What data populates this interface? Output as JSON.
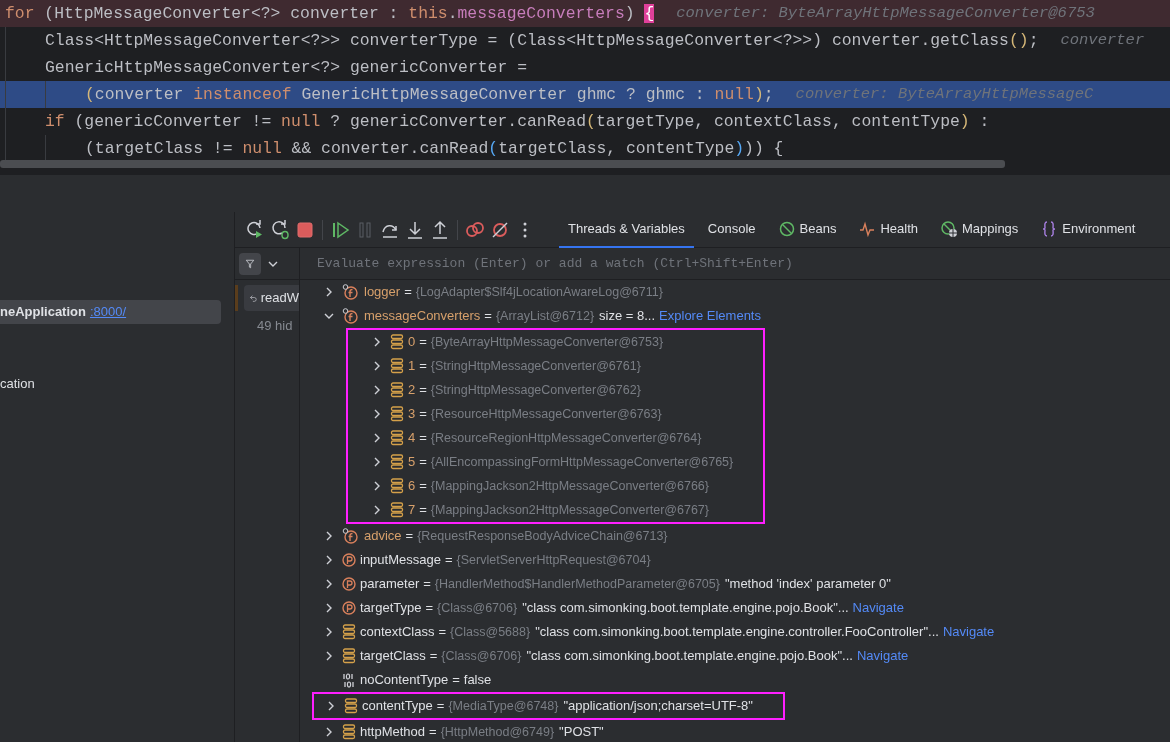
{
  "editor": {
    "lines": [
      {
        "kind": "outer",
        "breakpoint": true,
        "highlighted": false,
        "tokens": [
          {
            "t": "for",
            "kind": "keyword"
          },
          {
            "t": " (HttpMessageConverter<?> converter : ",
            "kind": "plain"
          },
          {
            "t": "this",
            "kind": "keyword"
          },
          {
            "t": ".",
            "kind": "plain"
          },
          {
            "t": "messageConverters",
            "kind": "field"
          },
          {
            "t": ") ",
            "kind": "plain"
          },
          {
            "t": "{",
            "kind": "match"
          }
        ],
        "hint": "converter: ByteArrayHttpMessageConverter@6753"
      },
      {
        "kind": "body",
        "breakpoint": false,
        "highlighted": false,
        "tokens": [
          {
            "t": "Class<HttpMessageConverter<?>> converterType = (Class<HttpMessageConverter<?>>) converter.getClass",
            "kind": "plain"
          },
          {
            "t": "()",
            "kind": "paren"
          },
          {
            "t": ";",
            "kind": "plain"
          }
        ],
        "hint": "converter"
      },
      {
        "kind": "body",
        "breakpoint": false,
        "highlighted": false,
        "tokens": [
          {
            "t": "GenericHttpMessageConverter<?> genericConverter =",
            "kind": "plain"
          }
        ]
      },
      {
        "kind": "wrapped",
        "breakpoint": false,
        "highlighted": true,
        "tokens": [
          {
            "t": "(",
            "kind": "paren"
          },
          {
            "t": "converter ",
            "kind": "plain"
          },
          {
            "t": "instanceof",
            "kind": "keyword"
          },
          {
            "t": " GenericHttpMessageConverter ghmc ? ghmc : ",
            "kind": "plain"
          },
          {
            "t": "null",
            "kind": "keyword"
          },
          {
            "t": ")",
            "kind": "paren"
          },
          {
            "t": ";",
            "kind": "plain"
          }
        ],
        "hint": "converter: ByteArrayHttpMessageC"
      },
      {
        "kind": "body",
        "breakpoint": false,
        "highlighted": false,
        "tokens": [
          {
            "t": "if",
            "kind": "keyword"
          },
          {
            "t": " (genericConverter != ",
            "kind": "plain"
          },
          {
            "t": "null",
            "kind": "keyword"
          },
          {
            "t": " ? genericConverter.canRead",
            "kind": "plain"
          },
          {
            "t": "(",
            "kind": "paren"
          },
          {
            "t": "targetType, contextClass, contentType",
            "kind": "plain"
          },
          {
            "t": ")",
            "kind": "paren"
          },
          {
            "t": " :",
            "kind": "plain"
          }
        ]
      },
      {
        "kind": "wrapped",
        "breakpoint": false,
        "highlighted": false,
        "tokens": [
          {
            "t": "(targetClass != ",
            "kind": "plain"
          },
          {
            "t": "null",
            "kind": "keyword"
          },
          {
            "t": " && converter.canRead",
            "kind": "plain"
          },
          {
            "t": "(",
            "kind": "call"
          },
          {
            "t": "targetClass, contentType",
            "kind": "plain"
          },
          {
            "t": ")",
            "kind": "call"
          },
          {
            "t": ")) {",
            "kind": "plain"
          }
        ]
      }
    ]
  },
  "services": {
    "items": [
      {
        "name": "neApplication",
        "link": ":8000/",
        "selected": true
      },
      {
        "name": "cation",
        "selected": false
      }
    ]
  },
  "toolbar": {
    "buttons": [
      {
        "kind": "rerun"
      },
      {
        "kind": "rerun-debug"
      },
      {
        "kind": "stop"
      },
      {
        "kind": "sep"
      },
      {
        "kind": "resume"
      },
      {
        "kind": "pause",
        "disabled": true
      },
      {
        "kind": "step-over"
      },
      {
        "kind": "step-into"
      },
      {
        "kind": "step-out"
      },
      {
        "kind": "sep"
      },
      {
        "kind": "breakpoints"
      },
      {
        "kind": "mute"
      },
      {
        "kind": "more"
      }
    ]
  },
  "tabs": [
    {
      "label": "Threads & Variables",
      "selected": true
    },
    {
      "label": "Console",
      "selected": false
    },
    {
      "label": "Beans",
      "selected": false
    },
    {
      "label": "Health",
      "selected": false
    },
    {
      "label": "Mappings",
      "selected": false
    },
    {
      "label": "Environment",
      "selected": false
    }
  ],
  "evaluate": {
    "placeholder": "Evaluate expression (Enter) or add a watch (Ctrl+Shift+Enter)"
  },
  "frames": {
    "current": "readW",
    "hidden": "49 hid"
  },
  "variables": [
    {
      "kind": "field",
      "name": "logger",
      "sep": "=",
      "value": "{LogAdapter$Slf4jLocationAwareLog@6711}",
      "expandable": true,
      "expanded": false
    },
    {
      "kind": "field",
      "name": "messageConverters",
      "sep": "=",
      "value": "{ArrayList@6712}",
      "extra": "size = 8...",
      "link": "Explore Elements",
      "expandable": true,
      "expanded": true,
      "children_boxed": true,
      "children": [
        {
          "kind": "element",
          "name": "0",
          "sep": "=",
          "value": "{ByteArrayHttpMessageConverter@6753}",
          "expandable": true,
          "expanded": false
        },
        {
          "kind": "element",
          "name": "1",
          "sep": "=",
          "value": "{StringHttpMessageConverter@6761}",
          "expandable": true,
          "expanded": false
        },
        {
          "kind": "element",
          "name": "2",
          "sep": "=",
          "value": "{StringHttpMessageConverter@6762}",
          "expandable": true,
          "expanded": false
        },
        {
          "kind": "element",
          "name": "3",
          "sep": "=",
          "value": "{ResourceHttpMessageConverter@6763}",
          "expandable": true,
          "expanded": false
        },
        {
          "kind": "element",
          "name": "4",
          "sep": "=",
          "value": "{ResourceRegionHttpMessageConverter@6764}",
          "expandable": true,
          "expanded": false
        },
        {
          "kind": "element",
          "name": "5",
          "sep": "=",
          "value": "{AllEncompassingFormHttpMessageConverter@6765}",
          "expandable": true,
          "expanded": false
        },
        {
          "kind": "element",
          "name": "6",
          "sep": "=",
          "value": "{MappingJackson2HttpMessageConverter@6766}",
          "expandable": true,
          "expanded": false
        },
        {
          "kind": "element",
          "name": "7",
          "sep": "=",
          "value": "{MappingJackson2HttpMessageConverter@6767}",
          "expandable": true,
          "expanded": false
        }
      ]
    },
    {
      "kind": "field",
      "name": "advice",
      "sep": "=",
      "value": "{RequestResponseBodyAdviceChain@6713}",
      "expandable": true,
      "expanded": false
    },
    {
      "kind": "param",
      "name": "inputMessage",
      "sep": "=",
      "value": "{ServletServerHttpRequest@6704}",
      "expandable": true,
      "expanded": false
    },
    {
      "kind": "param",
      "name": "parameter",
      "sep": "=",
      "value": "{HandlerMethod$HandlerMethodParameter@6705}",
      "extra": "\"method 'index' parameter 0\"",
      "expandable": true,
      "expanded": false
    },
    {
      "kind": "param",
      "name": "targetType",
      "sep": "=",
      "value": "{Class@6706}",
      "extra": "\"class com.simonking.boot.template.engine.pojo.Book\"...",
      "link": "Navigate",
      "expandable": true,
      "expanded": false
    },
    {
      "kind": "object",
      "name": "contextClass",
      "sep": "=",
      "value": "{Class@5688}",
      "extra": "\"class com.simonking.boot.template.engine.controller.FooController\"...",
      "link": "Navigate",
      "expandable": true,
      "expanded": false
    },
    {
      "kind": "object",
      "name": "targetClass",
      "sep": "=",
      "value": "{Class@6706}",
      "extra": "\"class com.simonking.boot.template.engine.pojo.Book\"...",
      "link": "Navigate",
      "expandable": true,
      "expanded": false
    },
    {
      "kind": "primitive",
      "name": "noContentType",
      "sep": "=",
      "value": "false",
      "expandable": false
    },
    {
      "kind": "object",
      "name": "contentType",
      "sep": "=",
      "value": "{MediaType@6748}",
      "extra": "\"application/json;charset=UTF-8\"",
      "expandable": true,
      "expanded": false,
      "boxed": true
    },
    {
      "kind": "object",
      "name": "httpMethod",
      "sep": "=",
      "value": "{HttpMethod@6749}",
      "extra": "\"POST\"",
      "expandable": true,
      "expanded": false
    }
  ]
}
